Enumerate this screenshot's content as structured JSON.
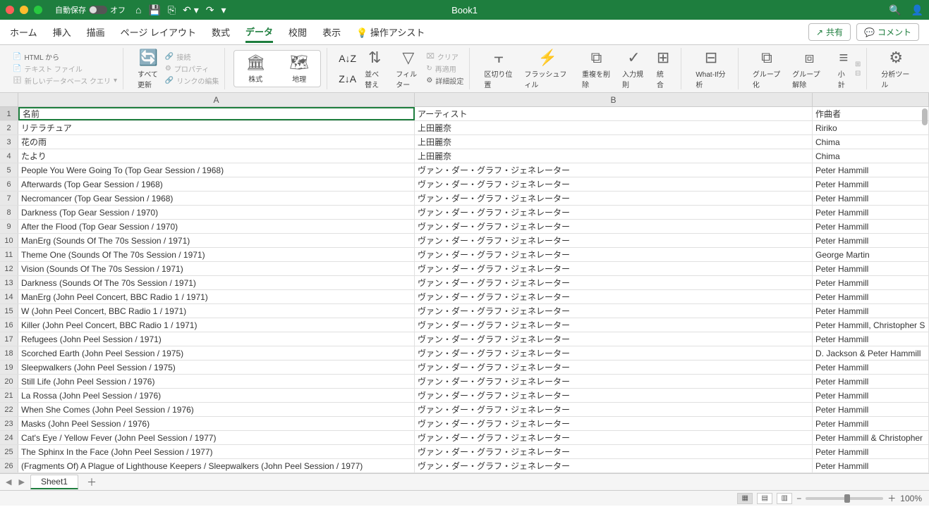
{
  "window": {
    "title": "Book1",
    "autosave_label": "自動保存",
    "autosave_state": "オフ"
  },
  "tabs": {
    "items": [
      "ホーム",
      "挿入",
      "描画",
      "ページ レイアウト",
      "数式",
      "データ",
      "校閲",
      "表示"
    ],
    "assist": "操作アシスト",
    "active": 5,
    "share": "共有",
    "comment": "コメント"
  },
  "ribbon": {
    "html_from": "HTML から",
    "text_file": "テキスト ファイル",
    "new_db": "新しいデータベース クエリ",
    "refresh_all": "すべて更新",
    "connect": "接続",
    "property": "プロパティ",
    "link_edit": "リンクの編集",
    "stocks": "株式",
    "geo": "地理",
    "sort": "並べ替え",
    "filter": "フィルター",
    "clear": "クリア",
    "reapply": "再適用",
    "advanced": "詳細設定",
    "split": "区切り位置",
    "flash": "フラッシュフィル",
    "dedupe": "重複を削除",
    "validate": "入力規則",
    "consolidate": "統合",
    "whatif": "What-If分析",
    "group": "グループ化",
    "ungroup": "グループ解除",
    "subtotal": "小計",
    "analysis": "分析ツール"
  },
  "columns": {
    "a": "A",
    "b": "B",
    "c": ""
  },
  "rows": [
    {
      "n": "1",
      "a": "名前",
      "b": "アーティスト",
      "c": "作曲者"
    },
    {
      "n": "2",
      "a": "リテラチュア",
      "b": "上田麗奈",
      "c": "Ririko"
    },
    {
      "n": "3",
      "a": "花の雨",
      "b": "上田麗奈",
      "c": "Chima"
    },
    {
      "n": "4",
      "a": "たより",
      "b": "上田麗奈",
      "c": "Chima"
    },
    {
      "n": "5",
      "a": "People You Were Going To (Top Gear Session / 1968)",
      "b": "ヴァン・ダー・グラフ・ジェネレーター",
      "c": "Peter Hammill"
    },
    {
      "n": "6",
      "a": "Afterwards (Top Gear Session / 1968)",
      "b": "ヴァン・ダー・グラフ・ジェネレーター",
      "c": "Peter Hammill"
    },
    {
      "n": "7",
      "a": "Necromancer (Top Gear Session / 1968)",
      "b": "ヴァン・ダー・グラフ・ジェネレーター",
      "c": "Peter Hammill"
    },
    {
      "n": "8",
      "a": "Darkness (Top Gear Session / 1970)",
      "b": "ヴァン・ダー・グラフ・ジェネレーター",
      "c": "Peter Hammill"
    },
    {
      "n": "9",
      "a": "After the Flood (Top Gear Session / 1970)",
      "b": "ヴァン・ダー・グラフ・ジェネレーター",
      "c": "Peter Hammill"
    },
    {
      "n": "10",
      "a": "ManErg (Sounds Of The 70s Session / 1971)",
      "b": "ヴァン・ダー・グラフ・ジェネレーター",
      "c": "Peter Hammill"
    },
    {
      "n": "11",
      "a": "Theme One (Sounds Of The 70s Session / 1971)",
      "b": "ヴァン・ダー・グラフ・ジェネレーター",
      "c": "George Martin"
    },
    {
      "n": "12",
      "a": "Vision (Sounds Of The 70s Session / 1971)",
      "b": "ヴァン・ダー・グラフ・ジェネレーター",
      "c": "Peter Hammill"
    },
    {
      "n": "13",
      "a": "Darkness (Sounds Of The 70s Session / 1971)",
      "b": "ヴァン・ダー・グラフ・ジェネレーター",
      "c": "Peter Hammill"
    },
    {
      "n": "14",
      "a": "ManErg (John Peel Concert, BBC Radio 1 / 1971)",
      "b": "ヴァン・ダー・グラフ・ジェネレーター",
      "c": "Peter Hammill"
    },
    {
      "n": "15",
      "a": "W (John Peel Concert, BBC Radio 1 / 1971)",
      "b": "ヴァン・ダー・グラフ・ジェネレーター",
      "c": "Peter Hammill"
    },
    {
      "n": "16",
      "a": "Killer (John Peel Concert, BBC Radio 1 / 1971)",
      "b": "ヴァン・ダー・グラフ・ジェネレーター",
      "c": "Peter Hammill, Christopher S"
    },
    {
      "n": "17",
      "a": "Refugees (John Peel Session / 1971)",
      "b": "ヴァン・ダー・グラフ・ジェネレーター",
      "c": "Peter Hammill"
    },
    {
      "n": "18",
      "a": "Scorched Earth (John Peel Session / 1975)",
      "b": "ヴァン・ダー・グラフ・ジェネレーター",
      "c": "D. Jackson & Peter Hammill"
    },
    {
      "n": "19",
      "a": "Sleepwalkers (John Peel Session / 1975)",
      "b": "ヴァン・ダー・グラフ・ジェネレーター",
      "c": "Peter Hammill"
    },
    {
      "n": "20",
      "a": "Still Life (John Peel Session / 1976)",
      "b": "ヴァン・ダー・グラフ・ジェネレーター",
      "c": "Peter Hammill"
    },
    {
      "n": "21",
      "a": "La Rossa (John Peel Session / 1976)",
      "b": "ヴァン・ダー・グラフ・ジェネレーター",
      "c": "Peter Hammill"
    },
    {
      "n": "22",
      "a": "When She Comes (John Peel Session / 1976)",
      "b": "ヴァン・ダー・グラフ・ジェネレーター",
      "c": "Peter Hammill"
    },
    {
      "n": "23",
      "a": "Masks (John Peel Session / 1976)",
      "b": "ヴァン・ダー・グラフ・ジェネレーター",
      "c": "Peter Hammill"
    },
    {
      "n": "24",
      "a": "Cat's Eye / Yellow Fever (John Peel Session / 1977)",
      "b": "ヴァン・ダー・グラフ・ジェネレーター",
      "c": "Peter Hammill & Christopher"
    },
    {
      "n": "25",
      "a": "The Sphinx In the Face (John Peel Session / 1977)",
      "b": "ヴァン・ダー・グラフ・ジェネレーター",
      "c": "Peter Hammill"
    },
    {
      "n": "26",
      "a": "(Fragments Of) A Plague of Lighthouse Keepers / Sleepwalkers (John Peel Session / 1977)",
      "b": "ヴァン・ダー・グラフ・ジェネレーター",
      "c": "Peter Hammill"
    }
  ],
  "sheet": {
    "name": "Sheet1"
  },
  "status": {
    "zoom": "100%"
  }
}
